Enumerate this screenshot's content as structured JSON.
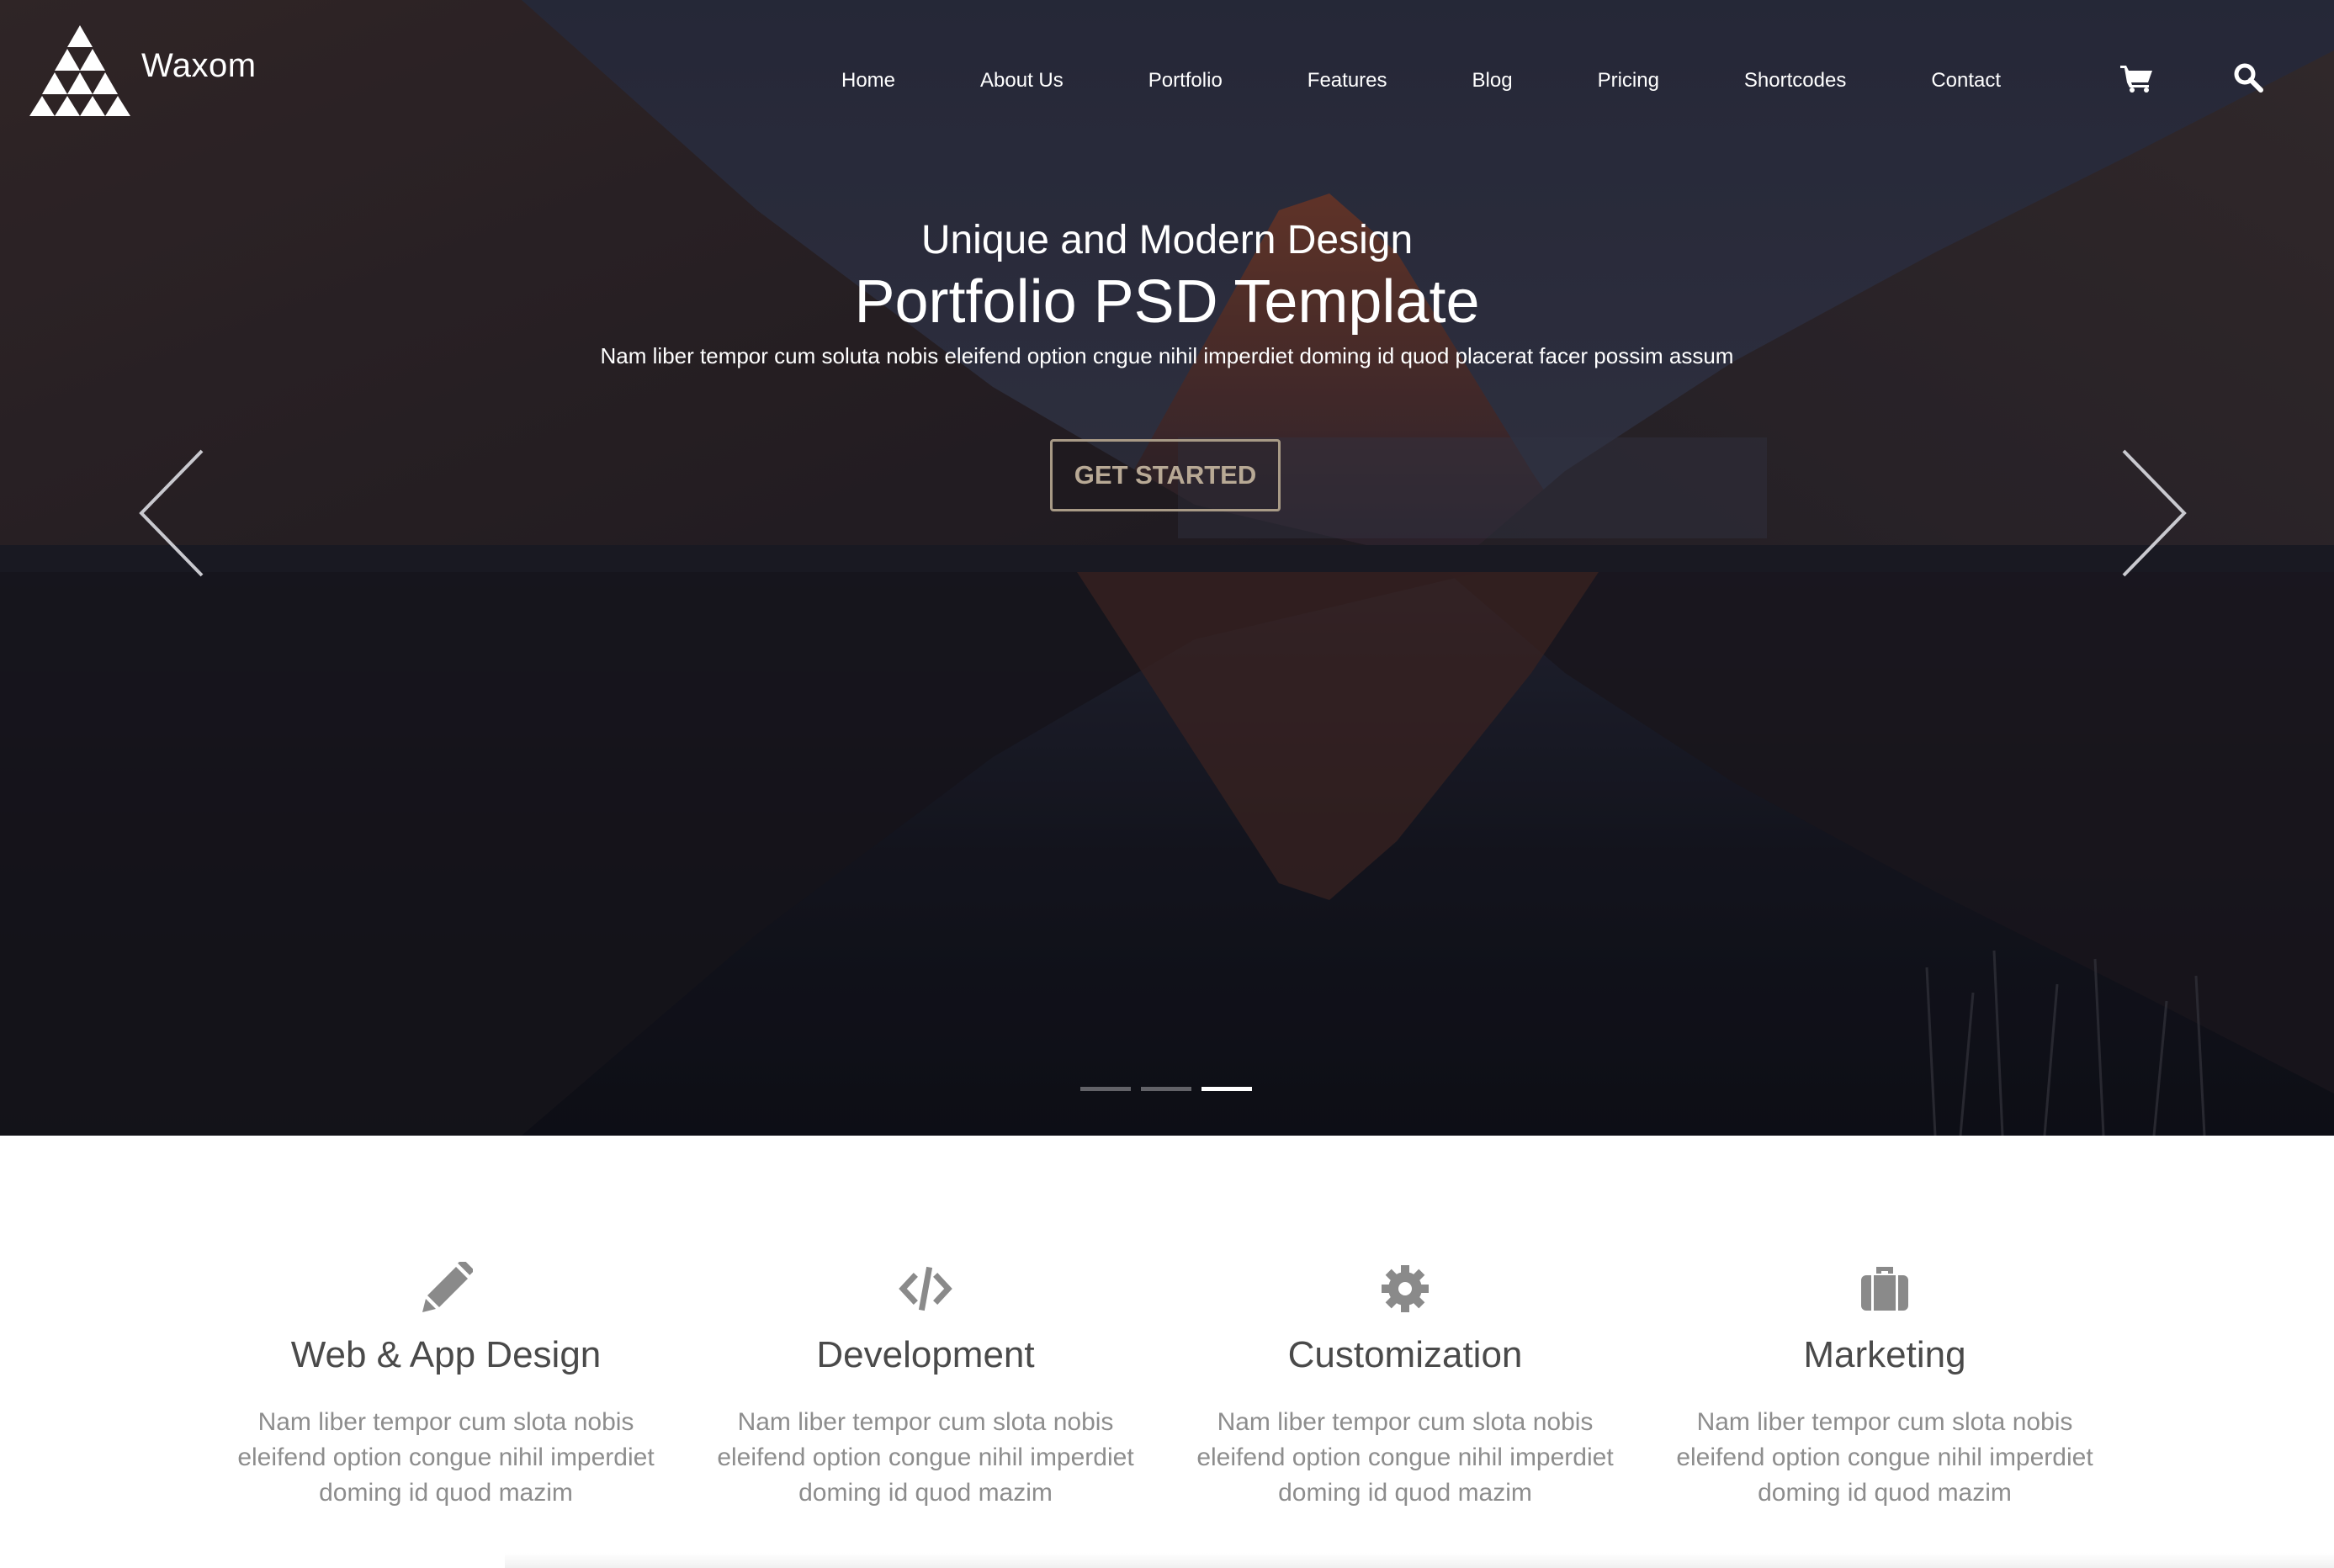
{
  "brand": {
    "name": "Waxom",
    "logo_icon": "triangle-logo-icon"
  },
  "nav": {
    "items": [
      "Home",
      "About Us",
      "Portfolio",
      "Features",
      "Blog",
      "Pricing",
      "Shortcodes",
      "Contact"
    ],
    "cart_icon": "cart-icon",
    "search_icon": "search-icon"
  },
  "hero": {
    "eyebrow": "Unique and Modern Design",
    "title": "Portfolio PSD Template",
    "subtitle": "Nam liber tempor cum soluta nobis eleifend option cngue nihil imperdiet doming id quod placerat facer possim assum",
    "cta_label": "GET STARTED",
    "prev_icon": "chevron-left-icon",
    "next_icon": "chevron-right-icon",
    "slides": {
      "count": 3,
      "active": 3
    }
  },
  "services": [
    {
      "icon": "pencil-icon",
      "title": "Web & App Design",
      "text": "Nam liber tempor cum slota nobis eleifend option congue nihil imperdiet doming id quod mazim"
    },
    {
      "icon": "code-icon",
      "title": "Development",
      "text": "Nam liber tempor cum slota nobis eleifend option congue nihil imperdiet doming id quod mazim"
    },
    {
      "icon": "gear-icon",
      "title": "Customization",
      "text": "Nam liber tempor cum slota nobis eleifend option congue nihil imperdiet doming id quod mazim"
    },
    {
      "icon": "briefcase-icon",
      "title": "Marketing",
      "text": "Nam liber tempor cum slota nobis eleifend option congue nihil imperdiet doming id quod mazim"
    }
  ],
  "colors": {
    "hero_overlay": "#1b1d2c",
    "cta_border": "#a89a86",
    "cta_text": "#b8a995",
    "service_title": "#4a4a4a",
    "service_text": "#8d8d8d",
    "service_icon": "#8a8a8a"
  }
}
